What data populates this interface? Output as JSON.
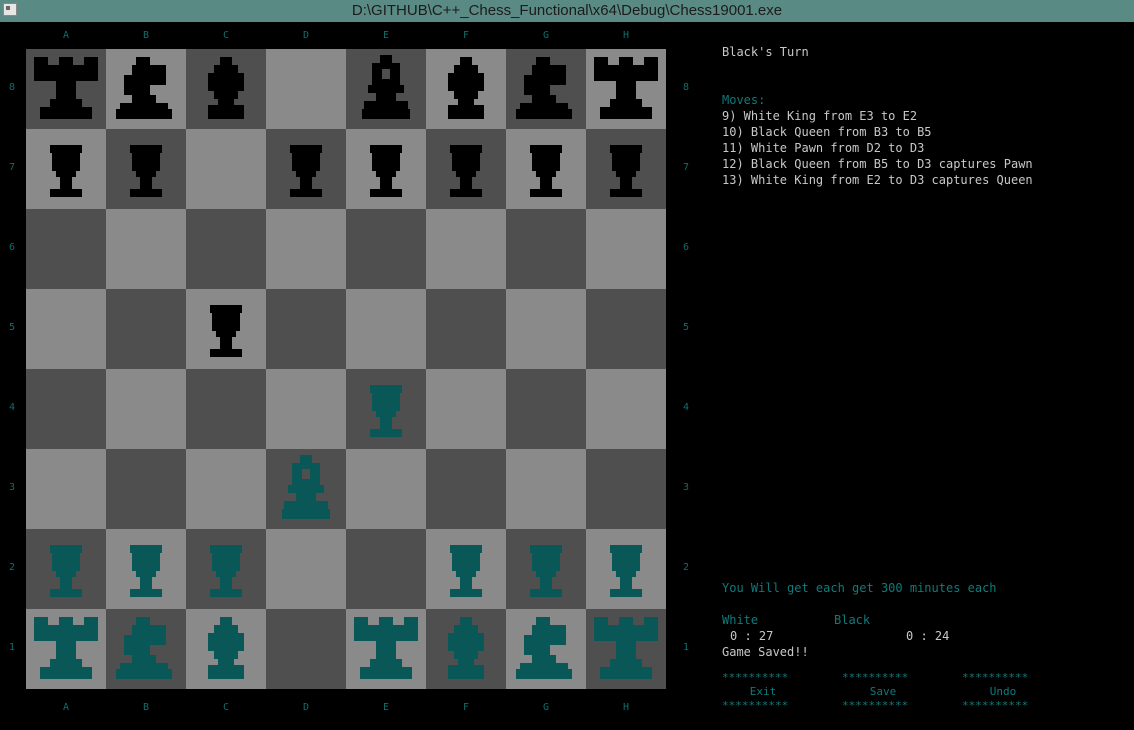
{
  "window": {
    "title": "D:\\GITHUB\\C++_Chess_Functional\\x64\\Debug\\Chess19001.exe"
  },
  "board": {
    "files": [
      "A",
      "B",
      "C",
      "D",
      "E",
      "F",
      "G",
      "H"
    ],
    "ranks": [
      "8",
      "7",
      "6",
      "5",
      "4",
      "3",
      "2",
      "1"
    ],
    "colors": {
      "light": "#8a8a8a",
      "dark": "#4f4f4f",
      "black_piece": "#000000",
      "white_piece": "#0a5757"
    },
    "rows": [
      [
        "bR",
        "bN",
        "bB",
        "",
        "bK",
        "bB",
        "bN",
        "bR"
      ],
      [
        "bP",
        "bP",
        "",
        "bP",
        "bP",
        "bP",
        "bP",
        "bP"
      ],
      [
        "",
        "",
        "",
        "",
        "",
        "",
        "",
        ""
      ],
      [
        "",
        "",
        "bP",
        "",
        "",
        "",
        "",
        ""
      ],
      [
        "",
        "",
        "",
        "",
        "wP",
        "",
        "",
        ""
      ],
      [
        "",
        "",
        "",
        "wK",
        "",
        "",
        "",
        ""
      ],
      [
        "wP",
        "wP",
        "wP",
        "",
        "",
        "wP",
        "wP",
        "wP"
      ],
      [
        "wR",
        "wN",
        "wB",
        "",
        "wR",
        "wB",
        "wN",
        "wR"
      ]
    ]
  },
  "status": {
    "turn": "Black's Turn"
  },
  "moves": {
    "heading": "Moves:",
    "list": [
      "9) White King from E3 to E2",
      "10) Black Queen from B3 to B5",
      "11) White Pawn from D2 to D3",
      "12) Black Queen from B5 to D3 captures Pawn",
      "13) White King from E2 to D3 captures Queen"
    ]
  },
  "timer": {
    "notice": "You Will get each get 300 minutes each",
    "white_label": "White",
    "black_label": "Black",
    "white_time": "0 : 27",
    "black_time": "0 : 24"
  },
  "save_status": "Game Saved!!",
  "buttons": {
    "border_top": "**********",
    "border_bottom": "**********",
    "exit": "Exit",
    "save": "Save",
    "undo": "Undo"
  }
}
